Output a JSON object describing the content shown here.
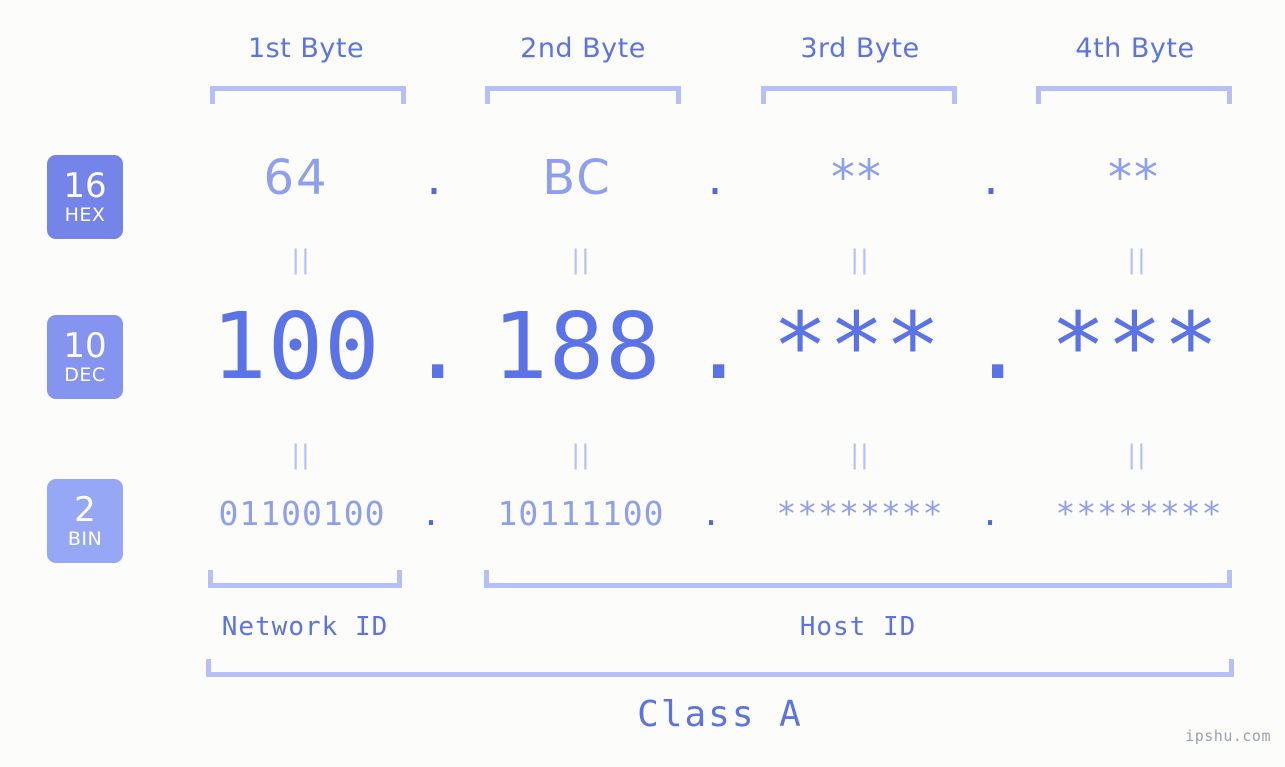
{
  "page": {
    "background_color": "#fcfdfa",
    "accent_color": "#5b73e8",
    "accent_light_color": "#8f9ff0",
    "bracket_color": "#b5bffa",
    "watermark": "ipshu.com"
  },
  "headers": [
    {
      "label": "1st Byte"
    },
    {
      "label": "2nd Byte"
    },
    {
      "label": "3rd Byte"
    },
    {
      "label": "4th Byte"
    }
  ],
  "bases": [
    {
      "num": "16",
      "name": "HEX",
      "color": "#7484e8"
    },
    {
      "num": "10",
      "name": "DEC",
      "color": "#8494ef"
    },
    {
      "num": "2",
      "name": "BIN",
      "color": "#95a7f5"
    }
  ],
  "separator": {
    "dot": ".",
    "equals": "||"
  },
  "rows": {
    "hex": {
      "base": "HEX",
      "values": [
        "64",
        "BC",
        "**",
        "**"
      ]
    },
    "dec": {
      "base": "DEC",
      "values": [
        "100",
        "188",
        "***",
        "***"
      ]
    },
    "bin": {
      "base": "BIN",
      "values": [
        "01100100",
        "10111100",
        "********",
        "********"
      ]
    }
  },
  "segments": {
    "network_id": "Network ID",
    "host_id": "Host ID",
    "class": "Class A"
  }
}
